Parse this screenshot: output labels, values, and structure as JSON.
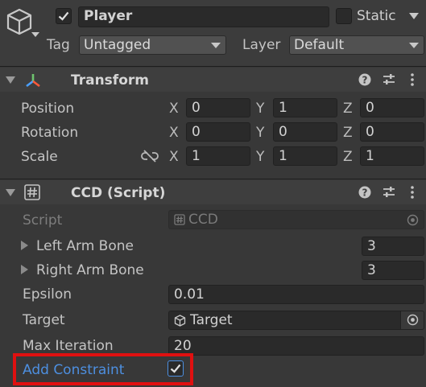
{
  "gameobject": {
    "name": "Player",
    "active": true,
    "static_label": "Static",
    "static": false,
    "tag_label": "Tag",
    "tag_value": "Untagged",
    "layer_label": "Layer",
    "layer_value": "Default"
  },
  "transform": {
    "title": "Transform",
    "rows": [
      {
        "label": "Position",
        "x": "0",
        "y": "1",
        "z": "0"
      },
      {
        "label": "Rotation",
        "x": "0",
        "y": "0",
        "z": "0"
      },
      {
        "label": "Scale",
        "x": "1",
        "y": "1",
        "z": "1"
      }
    ],
    "axes": {
      "x": "X",
      "y": "Y",
      "z": "Z"
    }
  },
  "ccd": {
    "title": "CCD (Script)",
    "script_label": "Script",
    "script_value": "CCD",
    "left_arm_label": "Left Arm Bone",
    "left_arm_value": "3",
    "right_arm_label": "Right Arm Bone",
    "right_arm_value": "3",
    "epsilon_label": "Epsilon",
    "epsilon_value": "0.01",
    "target_label": "Target",
    "target_value": "Target",
    "max_iteration_label": "Max Iteration",
    "max_iteration_value": "20",
    "add_constraint_label": "Add Constraint",
    "add_constraint": true
  },
  "colors": {
    "panel": "#383838",
    "field": "#2a2a2a",
    "highlight_label": "#4d8fe0",
    "annotation_box": "#e01010"
  },
  "icons": [
    "gameobject-cube-icon",
    "transform-axes-icon",
    "script-hash-icon",
    "help-icon",
    "preset-sliders-icon",
    "kebab-menu-icon",
    "unlink-scale-icon",
    "object-picker-icon"
  ]
}
